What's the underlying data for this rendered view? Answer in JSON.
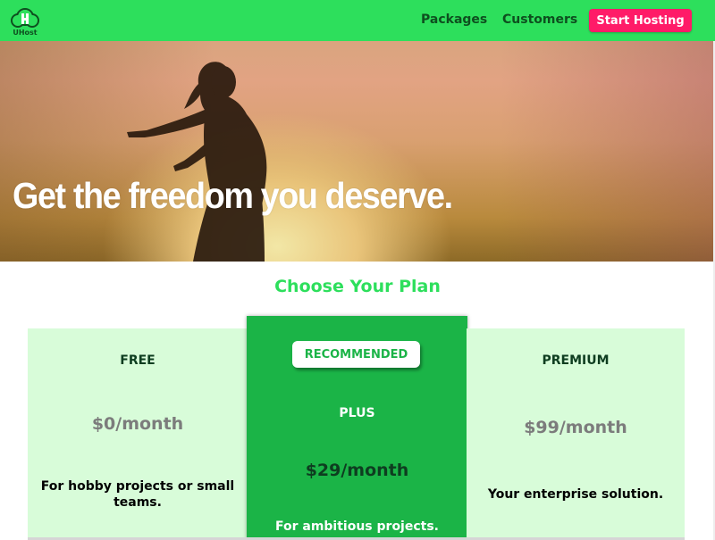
{
  "header": {
    "logo_text": "UHost",
    "nav": {
      "packages": "Packages",
      "customers": "Customers"
    },
    "cta": "Start Hosting"
  },
  "hero": {
    "title": "Get the freedom you deserve."
  },
  "plans_section": {
    "title": "Choose Your Plan",
    "plans": [
      {
        "name": "FREE",
        "price": "$0/month",
        "description": "For hobby projects or small teams."
      },
      {
        "name": "PLUS",
        "badge": "RECOMMENDED",
        "price": "$29/month",
        "description": "For ambitious projects."
      },
      {
        "name": "PREMIUM",
        "price": "$99/month",
        "description": "Your enterprise solution."
      }
    ]
  },
  "colors": {
    "brand_green": "#2ddf5c",
    "recommended_green": "#1bb447",
    "plan_bg": "#d8fcd9",
    "cta_pink": "#ff1b68"
  }
}
